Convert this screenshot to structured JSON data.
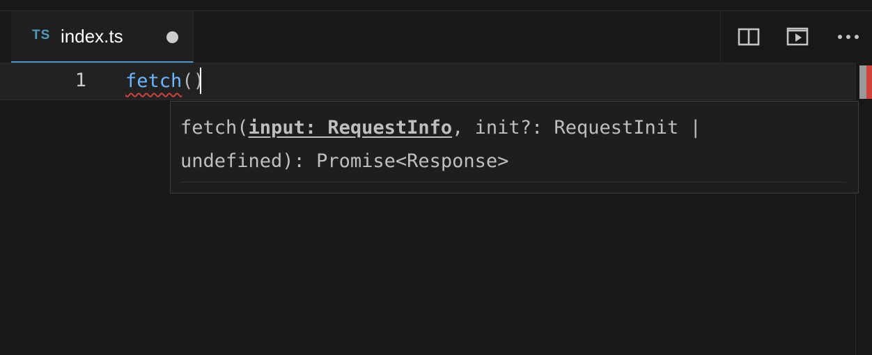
{
  "tab": {
    "language_badge": "TS",
    "filename": "index.ts",
    "dirty": true
  },
  "editor_actions": [
    {
      "name": "split-editor",
      "icon": "split-editor-icon"
    },
    {
      "name": "run-code",
      "icon": "play-preview-icon"
    },
    {
      "name": "more-actions",
      "icon": "ellipsis-icon"
    }
  ],
  "editor": {
    "line_number": "1",
    "code_function": "fetch",
    "code_open_paren": "(",
    "code_close_paren": ")"
  },
  "signature_help": {
    "prefix": "fetch(",
    "active_parameter": "input: RequestInfo",
    "rest": ", init?: RequestInit | undefined): Promise<Response>"
  },
  "colors": {
    "function_name": "#6cb6ff",
    "error_squiggle": "#d1423b",
    "tab_accent": "#4e94ce",
    "ts_badge": "#519aba"
  }
}
